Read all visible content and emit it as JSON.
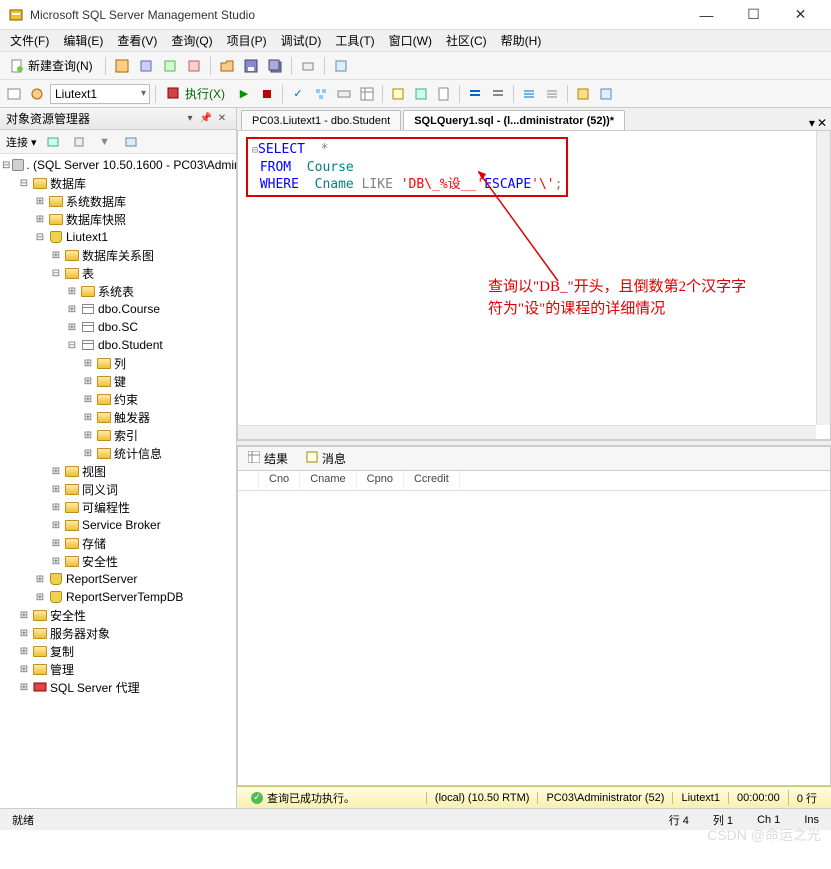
{
  "window": {
    "title": "Microsoft SQL Server Management Studio"
  },
  "menu": {
    "file": "文件(F)",
    "edit": "编辑(E)",
    "view": "查看(V)",
    "query": "查询(Q)",
    "project": "项目(P)",
    "debug": "调试(D)",
    "tools": "工具(T)",
    "window": "窗口(W)",
    "community": "社区(C)",
    "help": "帮助(H)"
  },
  "toolbar": {
    "newQuery": "新建查询(N)",
    "execute": "执行(X)"
  },
  "combos": {
    "database": "Liutext1"
  },
  "objectExplorer": {
    "title": "对象资源管理器",
    "connectLabel": "连接 ▾",
    "server": ". (SQL Server 10.50.1600 - PC03\\Administ",
    "nodes": {
      "databases": "数据库",
      "sysDbs": "系统数据库",
      "dbSnapshots": "数据库快照",
      "liutext1": "Liutext1",
      "dbDiagrams": "数据库关系图",
      "tables": "表",
      "sysTables": "系统表",
      "course": "dbo.Course",
      "sc": "dbo.SC",
      "student": "dbo.Student",
      "columns": "列",
      "keys": "键",
      "constraints": "约束",
      "triggers": "触发器",
      "indexes": "索引",
      "stats": "统计信息",
      "views": "视图",
      "synonyms": "同义词",
      "programmability": "可编程性",
      "serviceBroker": "Service Broker",
      "storage": "存储",
      "security2": "安全性",
      "reportServer": "ReportServer",
      "reportServerTemp": "ReportServerTempDB",
      "security": "安全性",
      "serverObjects": "服务器对象",
      "replication": "复制",
      "management": "管理",
      "sqlAgent": "SQL Server 代理"
    }
  },
  "tabs": {
    "inactive": "PC03.Liutext1 - dbo.Student",
    "active": "SQLQuery1.sql - (l...dministrator (52))*"
  },
  "sql": {
    "select": "SELECT",
    "star": "*",
    "from": "FROM",
    "course": "Course",
    "where": "WHERE",
    "cname": "Cname",
    "like": "LIKE",
    "str1": "'DB\\_%设__'",
    "escape": "ESCAPE",
    "str2": "'\\'",
    "semi": ";"
  },
  "annotation": {
    "line1": "查询以\"DB_\"开头，且倒数第2个汉字字",
    "line2": "符为\"设\"的课程的详细情况"
  },
  "results": {
    "tabResults": "结果",
    "tabMessages": "消息",
    "cols": {
      "cno": "Cno",
      "cname": "Cname",
      "cpno": "Cpno",
      "ccredit": "Ccredit"
    }
  },
  "queryStatus": {
    "msg": "查询已成功执行。",
    "server": "(local) (10.50 RTM)",
    "user": "PC03\\Administrator (52)",
    "db": "Liutext1",
    "time": "00:00:00",
    "rows": "0 行"
  },
  "status": {
    "ready": "就绪",
    "line": "行 4",
    "col": "列 1",
    "ch": "Ch 1",
    "ins": "Ins"
  },
  "watermark": "CSDN @命运之光"
}
